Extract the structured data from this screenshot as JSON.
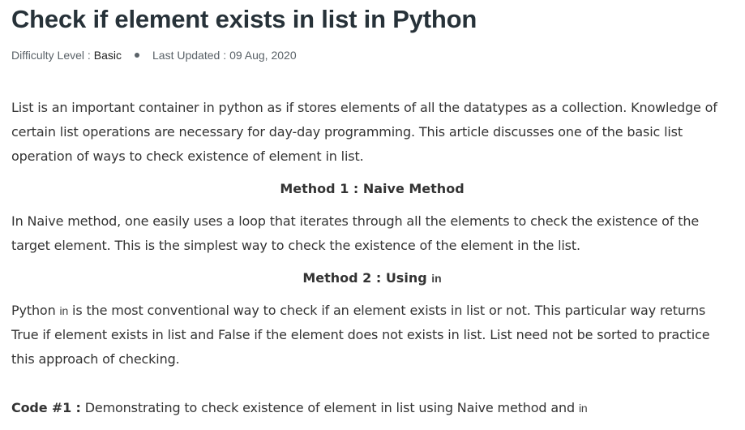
{
  "article": {
    "title": "Check if element exists in list in Python",
    "meta": {
      "difficulty_label": "Difficulty Level : ",
      "difficulty_value": "Basic",
      "updated_label": "Last Updated : ",
      "updated_value": "09 Aug, 2020"
    },
    "intro": "List is an important container in python as if stores elements of all the datatypes as a collection. Knowledge of certain list operations are necessary for day-day programming. This article discusses one of the basic list operation of ways to check existence of element in list.",
    "method1": {
      "heading": "Method 1 : Naive Method",
      "text": "In Naive method, one easily uses a loop that iterates through all the elements to check the existence of the target element. This is the simplest way to check the existence of the element in the list."
    },
    "method2": {
      "heading_prefix": "Method 2 : Using ",
      "heading_code": "in",
      "text_prefix": "Python ",
      "text_code": "in",
      "text_suffix": " is the most conventional way to check if an element exists in list or not. This particular way returns True if element exists in list and False if the element does not exists in list. List need not be sorted to practice this approach of checking."
    },
    "code1": {
      "label": "Code #1 :",
      "text": " Demonstrating to check existence of element in list using Naive method and ",
      "code": "in"
    }
  }
}
